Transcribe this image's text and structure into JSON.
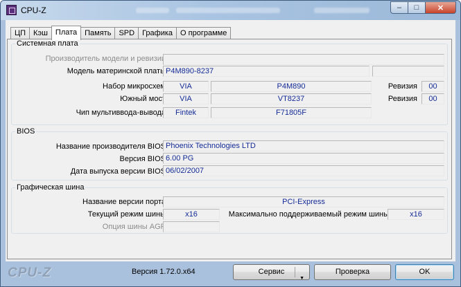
{
  "window": {
    "title": "CPU-Z",
    "buttons": {
      "min": "–",
      "max": "□",
      "close": "✕"
    },
    "icon": "cpu-z-chip-icon"
  },
  "tabs": [
    "ЦП",
    "Кэш",
    "Плата",
    "Память",
    "SPD",
    "Графика",
    "О программе"
  ],
  "active_tab": "Плата",
  "motherboard": {
    "group_title": "Системная плата",
    "manufacturer_label": "Производитель модели и ревизии",
    "manufacturer_value": "",
    "model_label": "Модель материнской платы",
    "model_value": "P4M890-8237",
    "model_extra": "",
    "chipset_label": "Набор микросхем",
    "chipset_vendor": "VIA",
    "chipset_model": "P4M890",
    "chipset_rev_label": "Ревизия",
    "chipset_rev": "00",
    "southbridge_label": "Южный мост",
    "southbridge_vendor": "VIA",
    "southbridge_model": "VT8237",
    "southbridge_rev_label": "Ревизия",
    "southbridge_rev": "00",
    "lpcio_label": "Чип мультиввода-вывода",
    "lpcio_vendor": "Fintek",
    "lpcio_model": "F71805F"
  },
  "bios": {
    "group_title": "BIOS",
    "brand_label": "Название производителя BIOS",
    "brand_value": "Phoenix Technologies LTD",
    "version_label": "Версия BIOS",
    "version_value": "6.00 PG",
    "date_label": "Дата выпуска версии BIOS",
    "date_value": "06/02/2007"
  },
  "graphic": {
    "group_title": "Графическая шина",
    "version_label": "Название версии порта",
    "version_value": "PCI-Express",
    "link_width_label": "Текущий режим шины",
    "link_width_value": "x16",
    "max_supported_label": "Максимально поддерживаемый режим шины",
    "max_supported_value": "x16",
    "agp_label": "Опция шины AGP",
    "agp_value": ""
  },
  "footer": {
    "brand": "CPU-Z",
    "version": "Версия 1.72.0.x64",
    "tools_button": "Сервис",
    "validate_button": "Проверка",
    "ok_button": "OK"
  }
}
